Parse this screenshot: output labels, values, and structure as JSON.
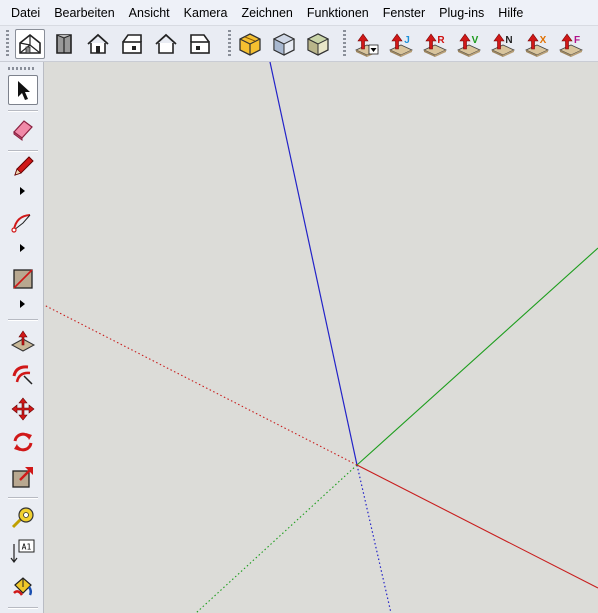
{
  "menu": {
    "items": [
      "Datei",
      "Bearbeiten",
      "Ansicht",
      "Kamera",
      "Zeichnen",
      "Funktionen",
      "Fenster",
      "Plug-ins",
      "Hilfe"
    ]
  },
  "toolbar_top": {
    "views": [
      "iso-view-icon",
      "top-view-icon",
      "front-view-icon",
      "right-view-icon",
      "back-view-icon",
      "left-view-icon"
    ],
    "styles": [
      "xray-style-icon",
      "wireframe-style-icon",
      "shaded-style-icon"
    ],
    "plugins": [
      {
        "icon": "plugin-push-dropdown-icon",
        "letter": "",
        "color": "#c00000"
      },
      {
        "icon": "plugin-j-icon",
        "letter": "J",
        "color": "#1e90d8"
      },
      {
        "icon": "plugin-r-icon",
        "letter": "R",
        "color": "#d01010"
      },
      {
        "icon": "plugin-v-icon",
        "letter": "V",
        "color": "#1a9a1a"
      },
      {
        "icon": "plugin-n-icon",
        "letter": "N",
        "color": "#222222"
      },
      {
        "icon": "plugin-x-icon",
        "letter": "X",
        "color": "#e07000"
      },
      {
        "icon": "plugin-f-icon",
        "letter": "F",
        "color": "#b0108a"
      }
    ]
  },
  "toolbar_left": {
    "tools": [
      "select-tool",
      "eraser-tool",
      "pencil-tool",
      "arc-tool",
      "rectangle-tool",
      "push-pull-tool",
      "follow-me-tool",
      "move-tool",
      "rotate-tool",
      "scale-tool",
      "tape-measure-tool",
      "text-tool",
      "paint-bucket-tool"
    ],
    "text_tool_label": "A1"
  },
  "colors": {
    "canvas_bg": "#dcdcd8",
    "axis_blue": "#2020c8",
    "axis_green": "#20a020",
    "axis_red": "#c81e1e"
  }
}
